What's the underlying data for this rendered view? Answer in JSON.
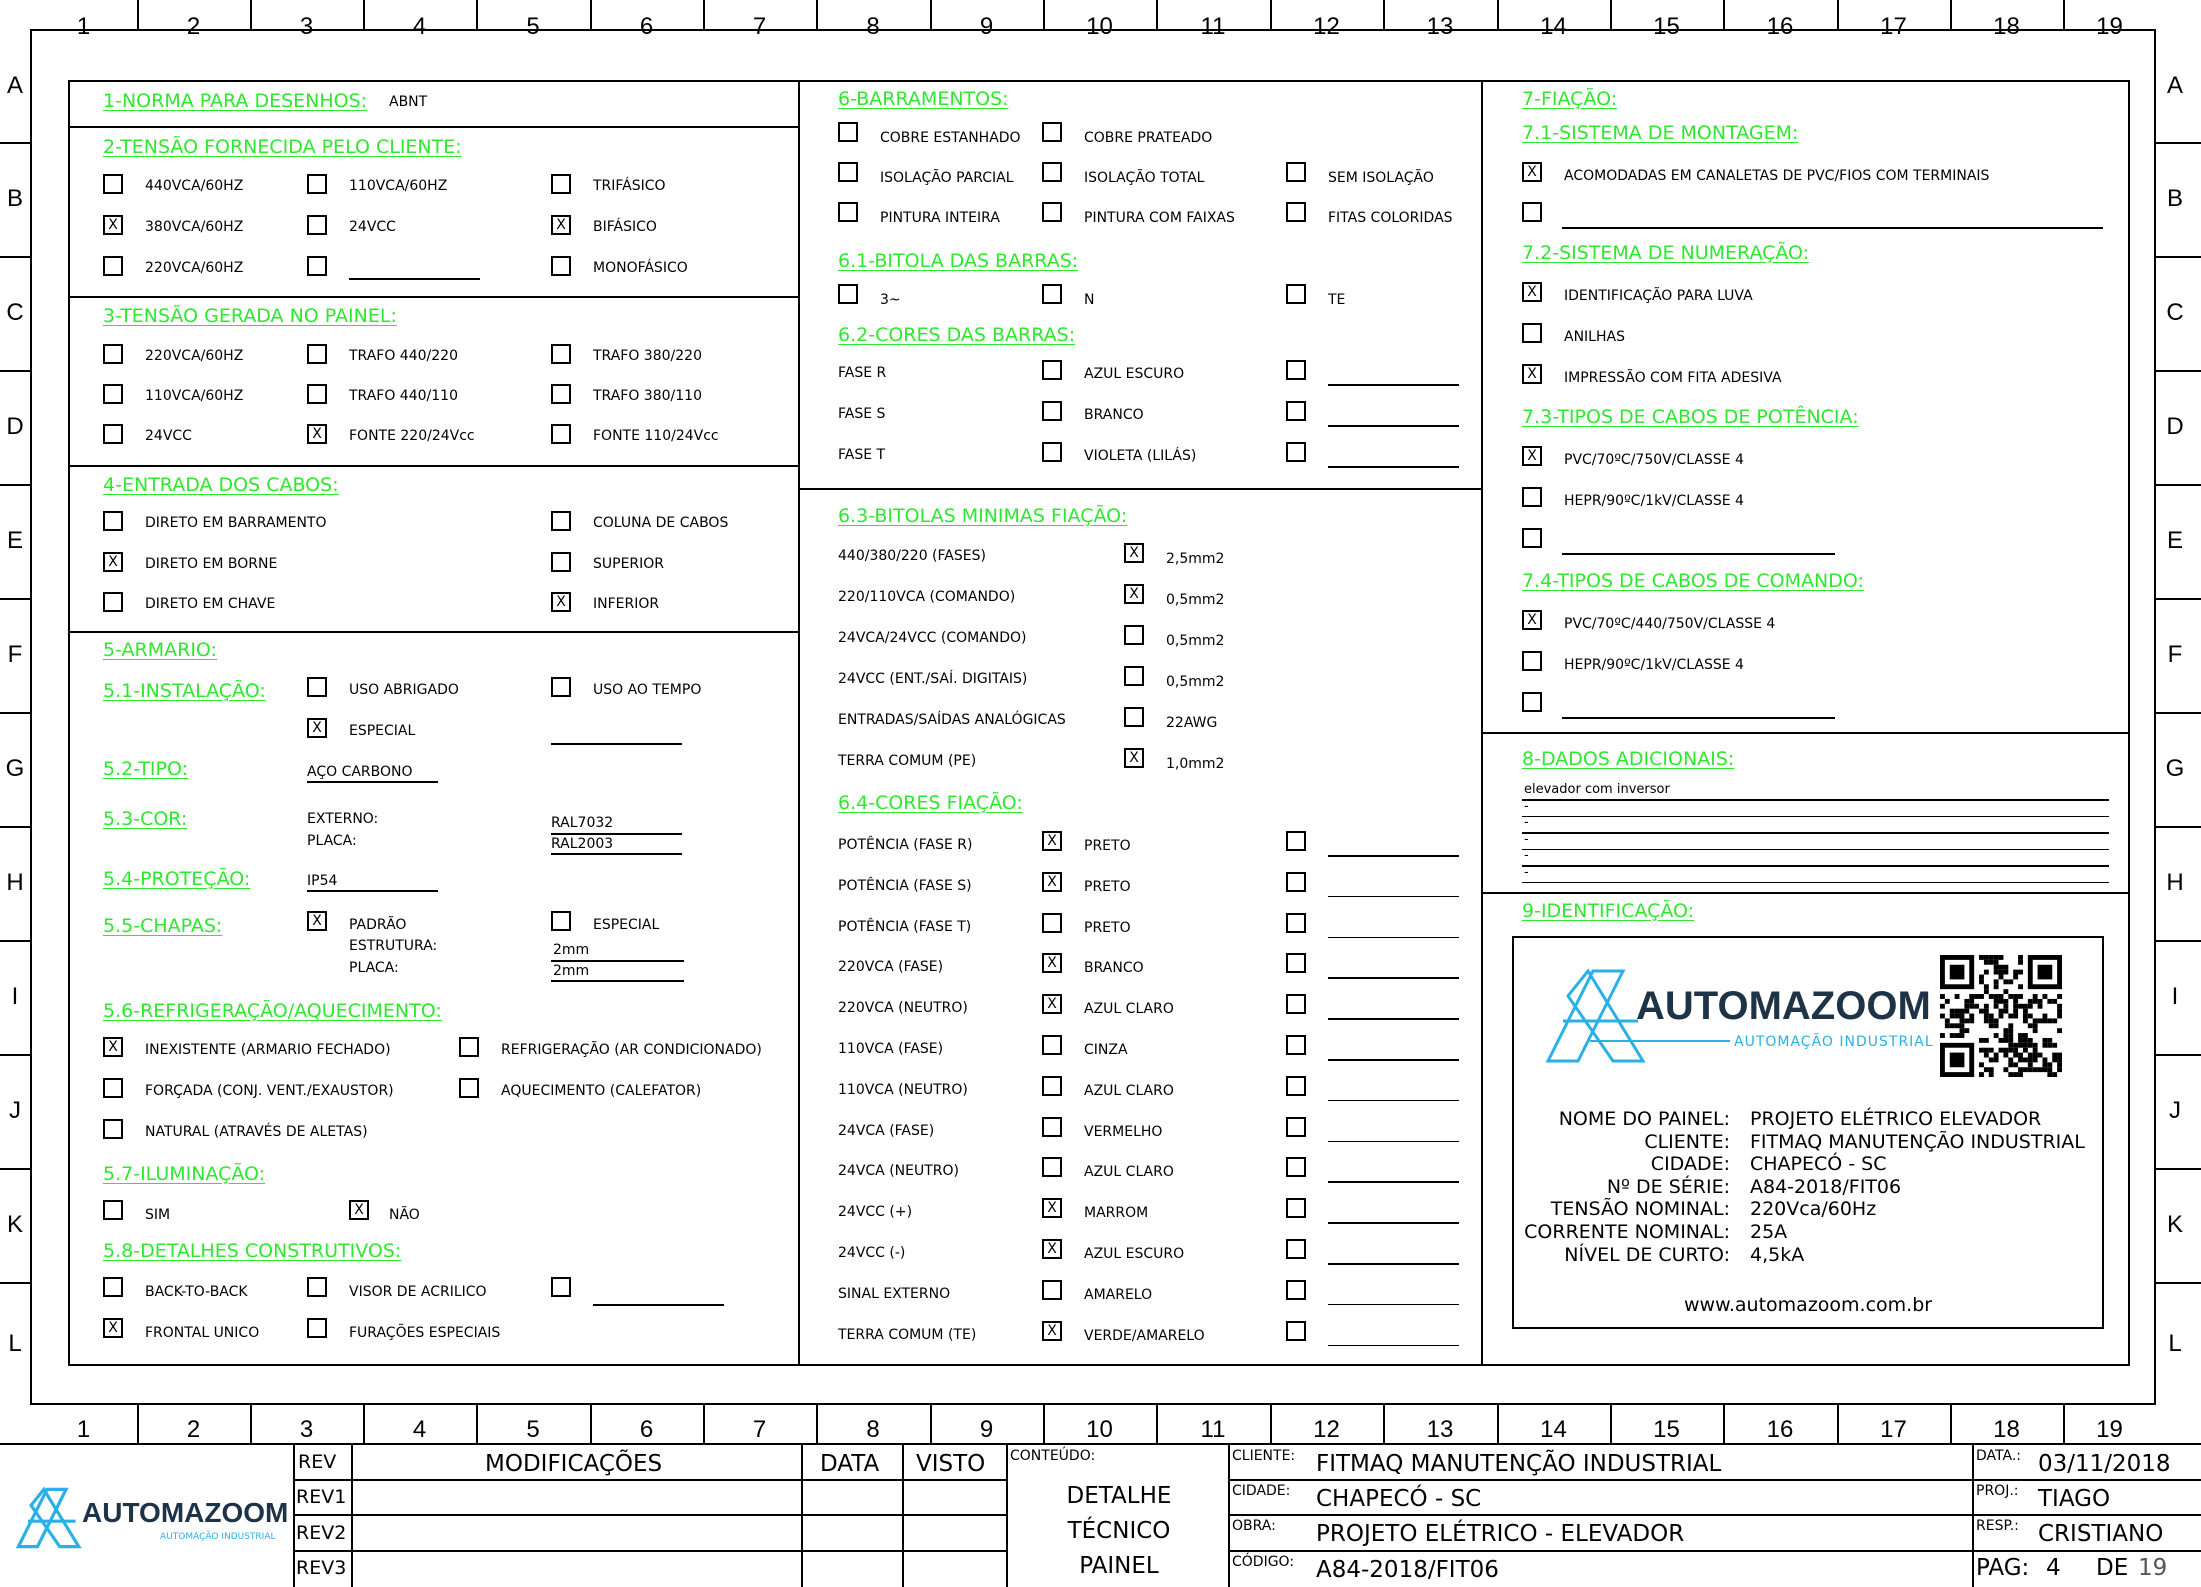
{
  "zones": {
    "cols": [
      "1",
      "2",
      "3",
      "4",
      "5",
      "6",
      "7",
      "8",
      "9",
      "10",
      "11",
      "12",
      "13",
      "14",
      "15",
      "16",
      "17",
      "18",
      "19"
    ],
    "rows": [
      "A",
      "B",
      "C",
      "D",
      "E",
      "F",
      "G",
      "H",
      "I",
      "J",
      "K",
      "L"
    ]
  },
  "s1": {
    "title": "1-NORMA PARA DESENHOS:",
    "value": "ABNT"
  },
  "s2": {
    "title": "2-TENSÃO FORNECIDA PELO CLIENTE:",
    "items": [
      {
        "label": "440VCA/60HZ",
        "checked": false
      },
      {
        "label": "110VCA/60HZ",
        "checked": false
      },
      {
        "label": "TRIFÁSICO",
        "checked": false
      },
      {
        "label": "380VCA/60HZ",
        "checked": true
      },
      {
        "label": "24VCC",
        "checked": false
      },
      {
        "label": "BIFÁSICO",
        "checked": true
      },
      {
        "label": "220VCA/60HZ",
        "checked": false
      },
      {
        "label": "",
        "checked": false
      },
      {
        "label": "MONOFÁSICO",
        "checked": false
      }
    ]
  },
  "s3": {
    "title": "3-TENSÃO GERADA NO PAINEL:",
    "items": [
      {
        "label": "220VCA/60HZ",
        "checked": false
      },
      {
        "label": "TRAFO 440/220",
        "checked": false
      },
      {
        "label": "TRAFO 380/220",
        "checked": false
      },
      {
        "label": "110VCA/60HZ",
        "checked": false
      },
      {
        "label": "TRAFO 440/110",
        "checked": false
      },
      {
        "label": "TRAFO 380/110",
        "checked": false
      },
      {
        "label": "24VCC",
        "checked": false
      },
      {
        "label": "FONTE 220/24Vcc",
        "checked": true
      },
      {
        "label": "FONTE 110/24Vcc",
        "checked": false
      }
    ]
  },
  "s4": {
    "title": "4-ENTRADA DOS CABOS:",
    "items": [
      {
        "label": "DIRETO EM BARRAMENTO",
        "checked": false
      },
      {
        "label": "COLUNA DE CABOS",
        "checked": false
      },
      {
        "label": "DIRETO EM BORNE",
        "checked": true
      },
      {
        "label": "SUPERIOR",
        "checked": false
      },
      {
        "label": "DIRETO EM CHAVE",
        "checked": false
      },
      {
        "label": "INFERIOR",
        "checked": true
      }
    ]
  },
  "s5": {
    "title": "5-ARMARIO:",
    "s51": {
      "title": "5.1-INSTALAÇÃO:",
      "items": [
        {
          "label": "USO ABRIGADO",
          "checked": false
        },
        {
          "label": "USO AO TEMPO",
          "checked": false
        },
        {
          "label": "ESPECIAL",
          "checked": true
        }
      ]
    },
    "s52": {
      "title": "5.2-TIPO:",
      "value": "AÇO CARBONO"
    },
    "s53": {
      "title": "5.3-COR:",
      "ext_label": "EXTERNO:",
      "placa_label": "PLACA:",
      "ext_value": "RAL7032",
      "placa_value": "RAL2003"
    },
    "s54": {
      "title": "5.4-PROTEÇÃO:",
      "value": "IP54"
    },
    "s55": {
      "title": "5.5-CHAPAS:",
      "items": [
        {
          "label": "PADRÃO",
          "checked": true
        },
        {
          "label": "ESPECIAL",
          "checked": false
        }
      ],
      "estrutura_label": "ESTRUTURA:",
      "placa_label": "PLACA:",
      "estrutura_value": "2mm",
      "placa_value": "2mm"
    },
    "s56": {
      "title": "5.6-REFRIGERAÇÃO/AQUECIMENTO:",
      "items": [
        {
          "label": "INEXISTENTE (ARMARIO FECHADO)",
          "checked": true
        },
        {
          "label": "REFRIGERAÇÃO (AR CONDICIONADO)",
          "checked": false
        },
        {
          "label": "FORÇADA (CONJ. VENT./EXAUSTOR)",
          "checked": false
        },
        {
          "label": "AQUECIMENTO (CALEFATOR)",
          "checked": false
        },
        {
          "label": "NATURAL (ATRAVÉS DE ALETAS)",
          "checked": false
        }
      ]
    },
    "s57": {
      "title": "5.7-ILUMINAÇÃO:",
      "items": [
        {
          "label": "SIM",
          "checked": false
        },
        {
          "label": "NÃO",
          "checked": true
        }
      ]
    },
    "s58": {
      "title": "5.8-DETALHES CONSTRUTIVOS:",
      "items": [
        {
          "label": "BACK-TO-BACK",
          "checked": false
        },
        {
          "label": "VISOR DE ACRILICO",
          "checked": false
        },
        {
          "label": "",
          "checked": false
        },
        {
          "label": "FRONTAL UNICO",
          "checked": true
        },
        {
          "label": "FURAÇÕES ESPECIAIS",
          "checked": false
        }
      ]
    }
  },
  "s6": {
    "title": "6-BARRAMENTOS:",
    "items": [
      {
        "label": "COBRE ESTANHADO",
        "checked": false
      },
      {
        "label": "COBRE PRATEADO",
        "checked": false
      },
      {
        "label": "ISOLAÇÃO PARCIAL",
        "checked": false
      },
      {
        "label": "ISOLAÇÃO TOTAL",
        "checked": false
      },
      {
        "label": "SEM ISOLAÇÃO",
        "checked": false
      },
      {
        "label": "PINTURA INTEIRA",
        "checked": false
      },
      {
        "label": "PINTURA COM FAIXAS",
        "checked": false
      },
      {
        "label": "FITAS COLORIDAS",
        "checked": false
      }
    ],
    "s61": {
      "title": "6.1-BITOLA DAS BARRAS:",
      "items": [
        {
          "label": "3~",
          "checked": false
        },
        {
          "label": "N",
          "checked": false
        },
        {
          "label": "TE",
          "checked": false
        }
      ]
    },
    "s62": {
      "title": "6.2-CORES DAS BARRAS:",
      "rows": [
        {
          "label": "FASE R",
          "color": "AZUL ESCURO",
          "checked": false
        },
        {
          "label": "FASE S",
          "color": "BRANCO",
          "checked": false
        },
        {
          "label": "FASE T",
          "color": "VIOLETA (LILÁS)",
          "checked": false
        }
      ]
    },
    "s63": {
      "title": "6.3-BITOLAS MINIMAS FIAÇÃO:",
      "rows": [
        {
          "label": "440/380/220 (FASES)",
          "value": "2,5mm2",
          "checked": true
        },
        {
          "label": "220/110VCA (COMANDO)",
          "value": "0,5mm2",
          "checked": true
        },
        {
          "label": "24VCA/24VCC (COMANDO)",
          "value": "0,5mm2",
          "checked": false
        },
        {
          "label": "24VCC (ENT./SAÍ. DIGITAIS)",
          "value": "0,5mm2",
          "checked": false
        },
        {
          "label": "ENTRADAS/SAÍDAS ANALÓGICAS",
          "value": "22AWG",
          "checked": false
        },
        {
          "label": "TERRA COMUM (PE)",
          "value": "1,0mm2",
          "checked": true
        }
      ]
    },
    "s64": {
      "title": "6.4-CORES FIAÇÃO:",
      "rows": [
        {
          "label": "POTÊNCIA (FASE R)",
          "color": "PRETO",
          "checked": true
        },
        {
          "label": "POTÊNCIA (FASE S)",
          "color": "PRETO",
          "checked": true
        },
        {
          "label": "POTÊNCIA (FASE T)",
          "color": "PRETO",
          "checked": false
        },
        {
          "label": "220VCA (FASE)",
          "color": "BRANCO",
          "checked": true
        },
        {
          "label": "220VCA (NEUTRO)",
          "color": "AZUL CLARO",
          "checked": true
        },
        {
          "label": "110VCA (FASE)",
          "color": "CINZA",
          "checked": false
        },
        {
          "label": "110VCA (NEUTRO)",
          "color": "AZUL CLARO",
          "checked": false
        },
        {
          "label": "24VCA (FASE)",
          "color": "VERMELHO",
          "checked": false
        },
        {
          "label": "24VCA (NEUTRO)",
          "color": "AZUL CLARO",
          "checked": false
        },
        {
          "label": "24VCC (+)",
          "color": "MARROM",
          "checked": true
        },
        {
          "label": "24VCC (-)",
          "color": "AZUL ESCURO",
          "checked": true
        },
        {
          "label": "SINAL EXTERNO",
          "color": "AMARELO",
          "checked": false
        },
        {
          "label": "TERRA COMUM (TE)",
          "color": "VERDE/AMARELO",
          "checked": true
        }
      ]
    }
  },
  "s7": {
    "title": "7-FIAÇÃO:",
    "s71": {
      "title": "7.1-SISTEMA DE MONTAGEM:",
      "items": [
        {
          "label": "ACOMODADAS EM CANALETAS DE PVC/FIOS COM TERMINAIS",
          "checked": true
        },
        {
          "label": "",
          "checked": false
        }
      ]
    },
    "s72": {
      "title": "7.2-SISTEMA DE NUMERAÇÃO:",
      "items": [
        {
          "label": "IDENTIFICAÇÃO PARA LUVA",
          "checked": true
        },
        {
          "label": "ANILHAS",
          "checked": false
        },
        {
          "label": "IMPRESSÃO COM FITA ADESIVA",
          "checked": true
        }
      ]
    },
    "s73": {
      "title": "7.3-TIPOS DE CABOS DE POTÊNCIA:",
      "items": [
        {
          "label": "PVC/70ºC/750V/CLASSE 4",
          "checked": true
        },
        {
          "label": "HEPR/90ºC/1kV/CLASSE 4",
          "checked": false
        },
        {
          "label": "",
          "checked": false
        }
      ]
    },
    "s74": {
      "title": "7.4-TIPOS DE CABOS DE COMANDO:",
      "items": [
        {
          "label": "PVC/70ºC/440/750V/CLASSE 4",
          "checked": true
        },
        {
          "label": "HEPR/90ºC/1kV/CLASSE 4",
          "checked": false
        },
        {
          "label": "",
          "checked": false
        }
      ]
    }
  },
  "s8": {
    "title": "8-DADOS ADICIONAIS:",
    "lines": [
      "elevador com inversor",
      "-",
      "-",
      "-",
      "-",
      "-"
    ]
  },
  "s9": {
    "title": "9-IDENTIFICAÇÃO:",
    "brand": "AUTOMAZOOM",
    "brand_sub": "AUTOMAÇÃO INDUSTRIAL",
    "fields": [
      {
        "label": "NOME DO PAINEL:",
        "value": "PROJETO ELÉTRICO ELEVADOR"
      },
      {
        "label": "CLIENTE:",
        "value": "FITMAQ MANUTENÇÃO INDUSTRIAL"
      },
      {
        "label": "CIDADE:",
        "value": "CHAPECÓ - SC"
      },
      {
        "label": "Nº DE SÉRIE:",
        "value": "A84-2018/FIT06"
      },
      {
        "label": "TENSÃO NOMINAL:",
        "value": "220Vca/60Hz"
      },
      {
        "label": "CORRENTE NOMINAL:",
        "value": "25A"
      },
      {
        "label": "NÍVEL DE CURTO:",
        "value": "4,5kA"
      }
    ],
    "website": "www.automazoom.com.br"
  },
  "titleblock": {
    "brand": "AUTOMAZOOM",
    "brand_sub": "AUTOMAÇÃO INDUSTRIAL",
    "rev_header": "REV",
    "mod_header": "MODIFICAÇÕES",
    "data_header": "DATA",
    "visto_header": "VISTO",
    "revs": [
      "REV1",
      "REV2",
      "REV3"
    ],
    "conteudo_label": "CONTEÚDO:",
    "conteudo_lines": [
      "DETALHE",
      "TÉCNICO",
      "PAINEL"
    ],
    "cliente_label": "CLIENTE:",
    "cliente": "FITMAQ MANUTENÇÃO INDUSTRIAL",
    "cidade_label": "CIDADE:",
    "cidade": "CHAPECÓ - SC",
    "obra_label": "OBRA:",
    "obra": "PROJETO ELÉTRICO - ELEVADOR",
    "codigo_label": "CÓDIGO:",
    "codigo": "A84-2018/FIT06",
    "data_label": "DATA.:",
    "data": "03/11/2018",
    "proj_label": "PROJ.:",
    "proj": "TIAGO",
    "resp_label": "RESP.:",
    "resp": "CRISTIANO",
    "pag_label": "PAG:",
    "pag": "4",
    "de_label": "DE",
    "total": "19"
  },
  "colors": {
    "heading": "#2ee82e",
    "logo_blue": "#2ab0e6",
    "logo_dark": "#1f3346"
  }
}
